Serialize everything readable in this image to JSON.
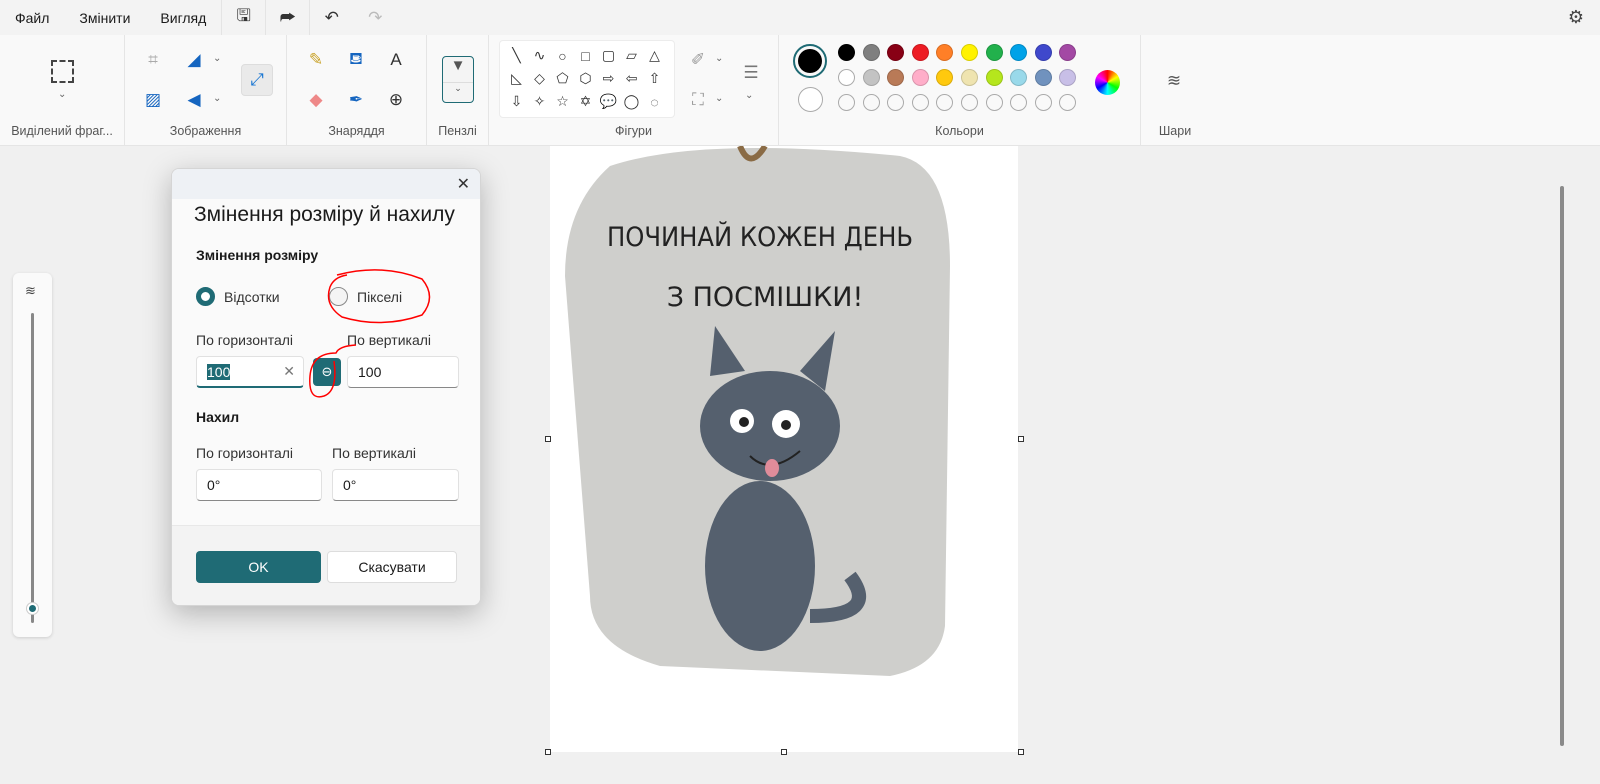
{
  "menu": {
    "file": "Файл",
    "edit": "Змінити",
    "view": "Вигляд"
  },
  "ribbon": {
    "selection": "Виділений фраг...",
    "image": "Зображення",
    "tools": "Знаряддя",
    "brushes": "Пензлі",
    "shapes": "Фігури",
    "colors": "Кольори",
    "layers": "Шари"
  },
  "shape_glyphs": [
    "╲",
    "∿",
    "○",
    "□",
    "▢",
    "▱",
    "△",
    "◺",
    "◇",
    "⬠",
    "⬡",
    "⇨",
    "⇦",
    "⇧",
    "⇩",
    "✧",
    "☆",
    "✡",
    "💬",
    "◯",
    "◌",
    "♡",
    "◁"
  ],
  "palette": {
    "primary": "#000000",
    "secondary": "#ffffff",
    "row1": [
      "#000000",
      "#7f7f7f",
      "#880015",
      "#ed1c24",
      "#ff7f27",
      "#fff200",
      "#22b14c",
      "#00a2e8",
      "#3f48cc",
      "#a349a4"
    ],
    "row2": [
      "#ffffff",
      "#c3c3c3",
      "#b97a57",
      "#ffaec9",
      "#ffc90e",
      "#efe4b0",
      "#b5e61d",
      "#99d9ea",
      "#7092be",
      "#c8bfe7"
    ],
    "accent": "#1f6b75"
  },
  "image_text": {
    "line1": "ПОЧИНАЙ КОЖЕН ДЕНЬ",
    "line2": "З ПОСМІШКИ!"
  },
  "dialog": {
    "title": "Змінення розміру й нахилу",
    "resize_heading": "Змінення розміру",
    "percent_label": "Відсотки",
    "pixels_label": "Пікселі",
    "horizontal_label": "По горизонталі",
    "vertical_label": "По вертикалі",
    "resize_h": "100",
    "resize_v": "100",
    "skew_heading": "Нахил",
    "skew_h_label": "По горизонталі",
    "skew_v_label": "По вертикалі",
    "skew_h": "0°",
    "skew_v": "0°",
    "ok": "OK",
    "cancel": "Скасувати"
  }
}
